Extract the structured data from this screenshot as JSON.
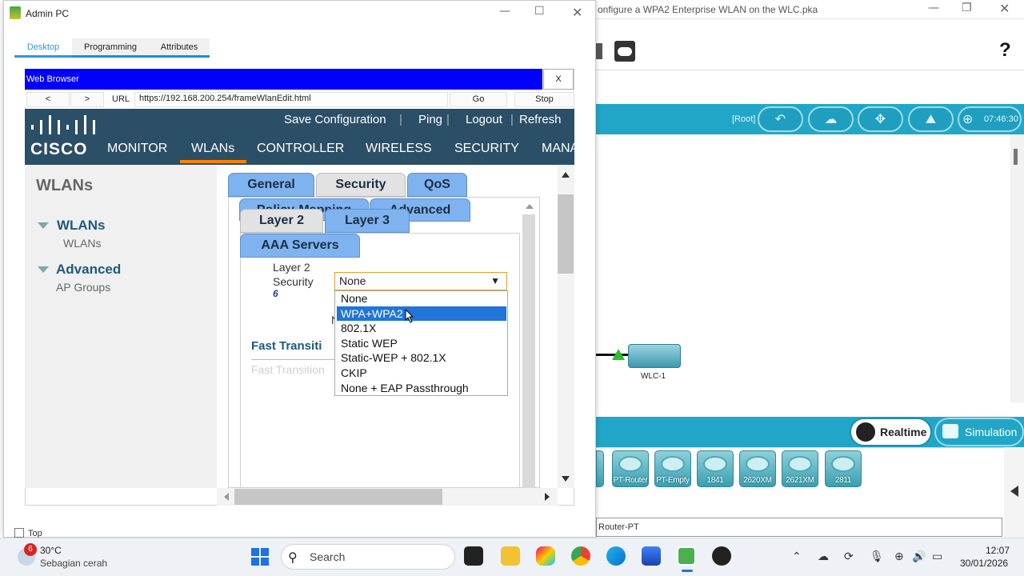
{
  "background_app": {
    "title": "onfigure a WPA2 Enterprise WLAN on the WLC.pka",
    "help_glyph": "?",
    "root_label": "[Root]",
    "clock": "07:46:30",
    "canvas_device_label": "WLC-1",
    "modes": {
      "realtime": "Realtime",
      "simulation": "Simulation"
    },
    "devices": [
      "PT-Router",
      "PT-Empty",
      "1841",
      "2620XM",
      "2621XM",
      "2811"
    ],
    "status_field": "Router-PT"
  },
  "admin_window": {
    "title": "Admin PC",
    "tabs": [
      "Desktop",
      "Programming",
      "Attributes"
    ],
    "top_checkbox_label": "Top"
  },
  "browser": {
    "title": "Web Browser",
    "close": "X",
    "back": "<",
    "forward": ">",
    "url_label": "URL",
    "url": "https://192.168.200.254/frameWlanEdit.html",
    "go": "Go",
    "stop": "Stop"
  },
  "cisco": {
    "logo_text": "CISCO",
    "top_links": [
      "Save Configuration",
      "Ping",
      "Logout",
      "Refresh"
    ],
    "menu": [
      "MONITOR",
      "WLANs",
      "CONTROLLER",
      "WIRELESS",
      "SECURITY",
      "MANA"
    ],
    "sidebar": {
      "title": "WLANs",
      "groups": [
        {
          "label": "WLANs",
          "items": [
            "WLANs"
          ]
        },
        {
          "label": "Advanced",
          "items": [
            "AP Groups"
          ]
        }
      ]
    },
    "tabs": {
      "row1": [
        "General",
        "Security",
        "QoS"
      ],
      "row2": [
        "Policy-Mapping",
        "Advanced"
      ],
      "row3": [
        "Layer 2",
        "Layer 3"
      ],
      "row4": [
        "AAA Servers"
      ]
    },
    "layer2_label_line1": "Layer 2",
    "layer2_label_line2": "Security",
    "marker": "6",
    "selected_value": "None",
    "hidden_partial": "N",
    "options": [
      "None",
      "WPA+WPA2",
      "802.1X",
      "Static WEP",
      "Static-WEP + 802.1X",
      "CKIP",
      "None + EAP Passthrough"
    ],
    "highlighted_option": "WPA+WPA2",
    "fast_transition_heading": "Fast Transiti",
    "fast_transition_sub": "Fast Transition"
  },
  "taskbar": {
    "weather_temp": "30°C",
    "weather_desc": "Sebagian cerah",
    "weather_badge": "6",
    "search_placeholder": "Search",
    "time": "12:07",
    "date": "30/01/2026"
  }
}
